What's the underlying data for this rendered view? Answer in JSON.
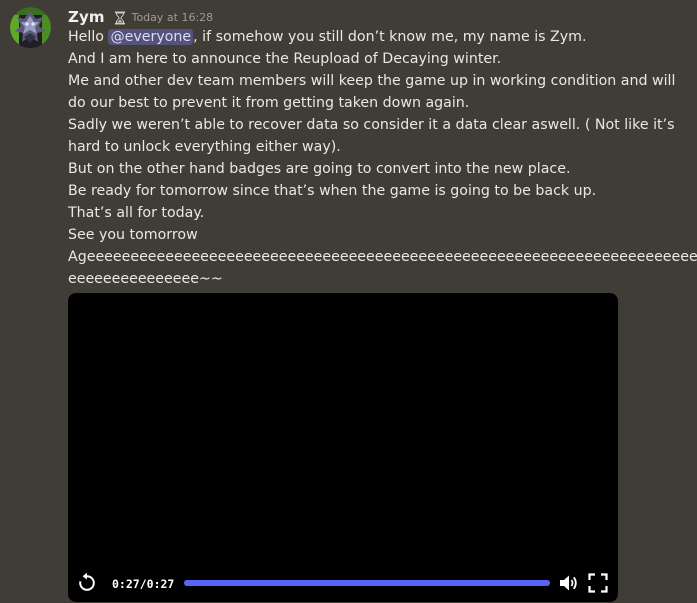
{
  "message": {
    "author": "Zym",
    "badge_icon": "hourglass-icon",
    "timestamp": "Today at 16:28",
    "lines": [
      {
        "before": "Hello ",
        "mention": "@everyone",
        "after": ", if somehow you still don’t know me, my name is Zym."
      },
      "And I am here to announce the Reupload of Decaying winter.",
      "Me and other dev team members will keep the game up in working condition and will",
      "do our best to prevent it from getting taken down again.",
      "Sadly we weren’t able to recover data so consider it a data clear aswell. ( Not like it’s",
      "hard to unlock everything either way).",
      "But on the other hand badges are going to convert into the new place.",
      "Be ready for tomorrow since that’s when the game is going to be back up.",
      "That’s all for today.",
      "See you tomorrow",
      "Ageeeeeeeeeeeeeeeeeeeeeeeeeeeeeeeeeeeeeeeeeeeeeeeeeeeeeeeeeeeeeeeeeeeeeee",
      "eeeeeeeeeeeeeee~~"
    ]
  },
  "video": {
    "current_time": "0:27",
    "separator": "/",
    "duration": "0:27",
    "progress_fraction": 1.0,
    "icons": {
      "replay": "replay-icon",
      "volume": "volume-icon",
      "fullscreen": "fullscreen-icon"
    }
  },
  "colors": {
    "background": "#403c36",
    "mention_bg": "#55537a",
    "mention_text": "#d9dcff",
    "progress_accent": "#5865f2",
    "timestamp": "#a09b94"
  }
}
